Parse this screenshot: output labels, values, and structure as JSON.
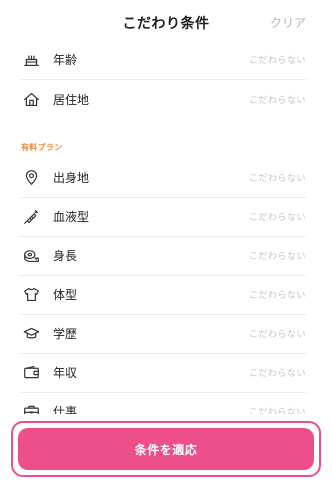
{
  "header": {
    "title": "こだわり条件",
    "clear_label": "クリア"
  },
  "rows_basic": [
    {
      "label": "年齢",
      "value": "こだわらない",
      "icon": "cake-icon"
    },
    {
      "label": "居住地",
      "value": "こだわらない",
      "icon": "house-icon"
    }
  ],
  "section": {
    "paid_label": "有料プラン"
  },
  "rows_paid": [
    {
      "label": "出身地",
      "value": "こだわらない",
      "icon": "location-pin-icon"
    },
    {
      "label": "血液型",
      "value": "こだわらない",
      "icon": "syringe-icon"
    },
    {
      "label": "身長",
      "value": "こだわらない",
      "icon": "tape-measure-icon"
    },
    {
      "label": "体型",
      "value": "こだわらない",
      "icon": "shirt-icon"
    },
    {
      "label": "学歴",
      "value": "こだわらない",
      "icon": "graduation-cap-icon"
    },
    {
      "label": "年収",
      "value": "こだわらない",
      "icon": "wallet-icon"
    },
    {
      "label": "仕事",
      "value": "こだわらない",
      "icon": "briefcase-icon"
    }
  ],
  "footer": {
    "apply_label": "条件を適応"
  },
  "colors": {
    "accent": "#ec4f8a",
    "section_label": "#f08a3a",
    "muted_text": "#c4c4c4",
    "clear_text": "#b5b5b5"
  }
}
